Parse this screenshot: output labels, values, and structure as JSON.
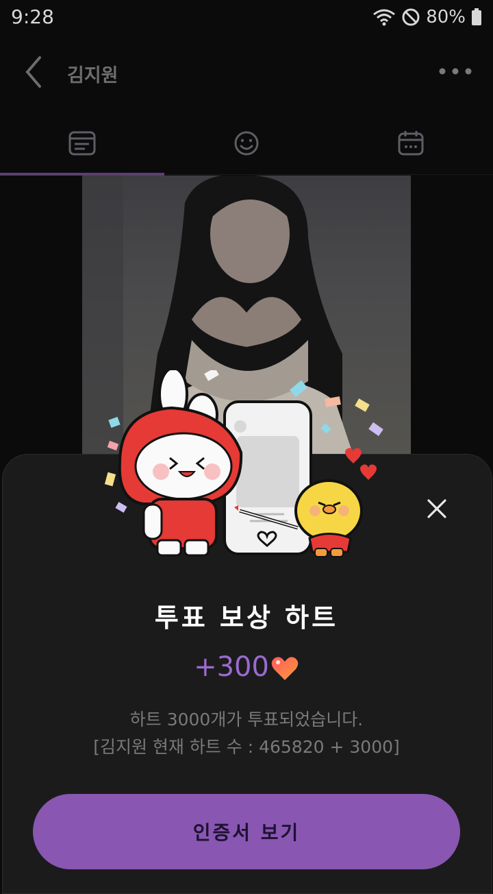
{
  "status_bar": {
    "time": "9:28",
    "battery": "80%"
  },
  "header": {
    "title": "김지원"
  },
  "tabs": [
    {
      "icon": "feed-icon"
    },
    {
      "icon": "smile-icon"
    },
    {
      "icon": "calendar-icon"
    }
  ],
  "dialog": {
    "title": "투표 보상 하트",
    "reward": "+300",
    "description_line1": "하트 3000개가 투표되었습니다.",
    "description_line2": "[김지원 현재 하트 수 : 465820 + 3000]",
    "cta_label": "인증서 보기"
  },
  "colors": {
    "accent": "#8956b2",
    "reward_text": "#9b6bd0",
    "sheet_bg": "#1b1b1c"
  }
}
